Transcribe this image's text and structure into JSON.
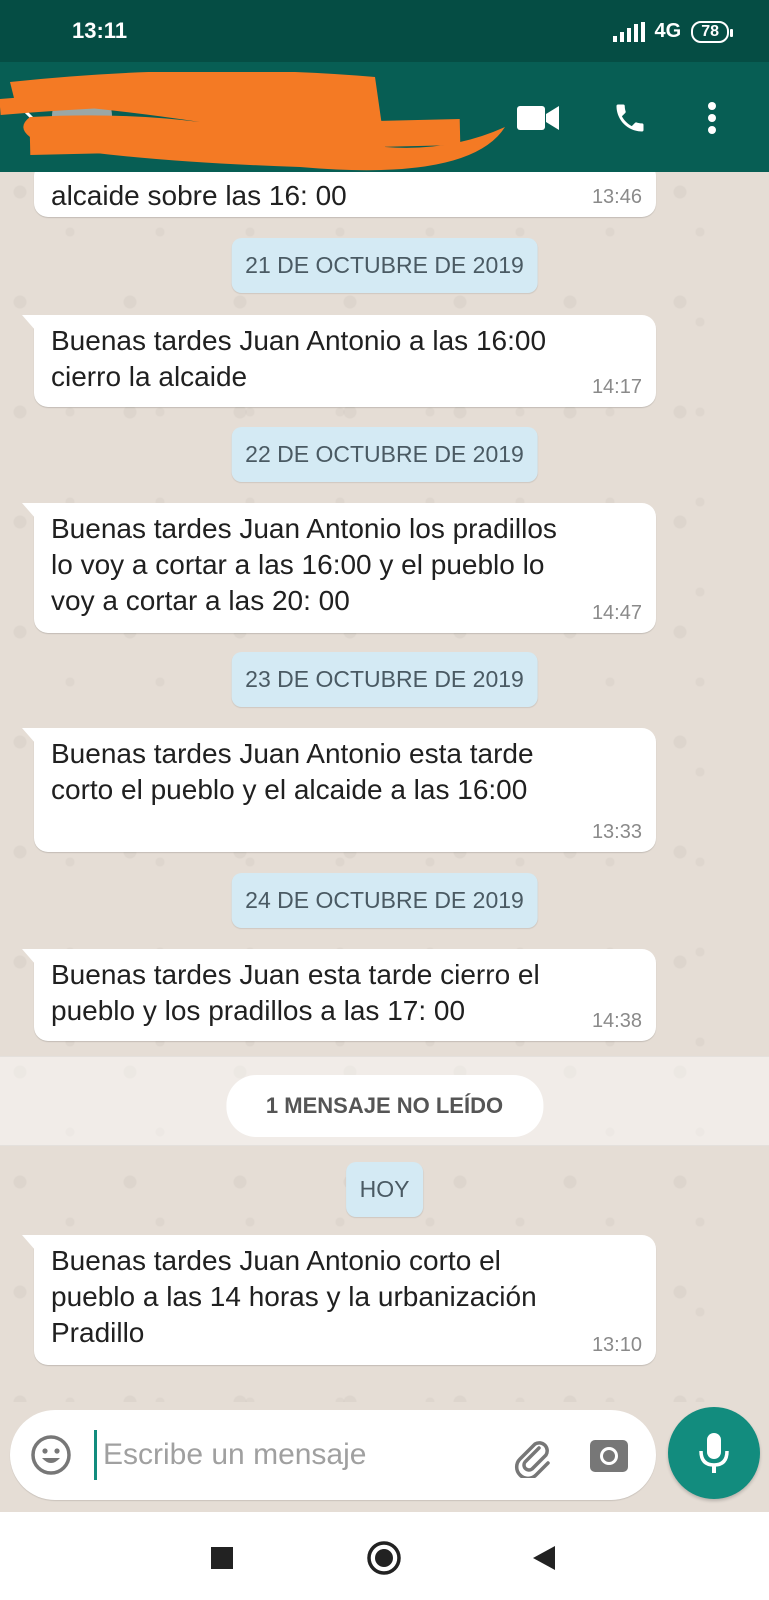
{
  "status_bar": {
    "time": "13:11",
    "network": "4G",
    "battery": "78"
  },
  "header": {
    "contact_name": "",
    "icons": [
      "back-arrow-icon",
      "avatar",
      "video-call-icon",
      "phone-icon",
      "more-vert-icon"
    ]
  },
  "chat": {
    "messages": [
      {
        "text": "alcaide sobre las 16: 00",
        "time": "13:46"
      },
      {
        "text": "Buenas tardes Juan Antonio a las 16:00 cierro la alcaide",
        "time": "14:17"
      },
      {
        "text": "Buenas tardes Juan Antonio los pradillos lo voy a cortar a las 16:00 y el pueblo lo voy a cortar a las 20: 00",
        "time": "14:47"
      },
      {
        "text": "Buenas tardes Juan Antonio esta tarde corto el pueblo y el alcaide a las 16:00",
        "time": "13:33"
      },
      {
        "text": "Buenas tardes Juan esta tarde cierro el pueblo y los pradillos a las 17: 00",
        "time": "14:38"
      },
      {
        "text": "Buenas tardes Juan Antonio corto el pueblo a las 14 horas y la urbanización Pradillo",
        "time": "13:10"
      }
    ],
    "date_chips": [
      "21 DE OCTUBRE DE 2019",
      "22 DE OCTUBRE DE 2019",
      "23 DE OCTUBRE DE 2019",
      "24 DE OCTUBRE DE 2019",
      "HOY"
    ],
    "unread_label": "1 MENSAJE NO LEÍDO"
  },
  "composer": {
    "placeholder": "Escribe un mensaje",
    "value": ""
  },
  "colors": {
    "header": "#075e54",
    "status_bar": "#054d44",
    "accent": "#128c7e",
    "date_chip": "#d4eaf4",
    "chat_bg": "#e5ddd5",
    "redaction": "#f47a24"
  }
}
